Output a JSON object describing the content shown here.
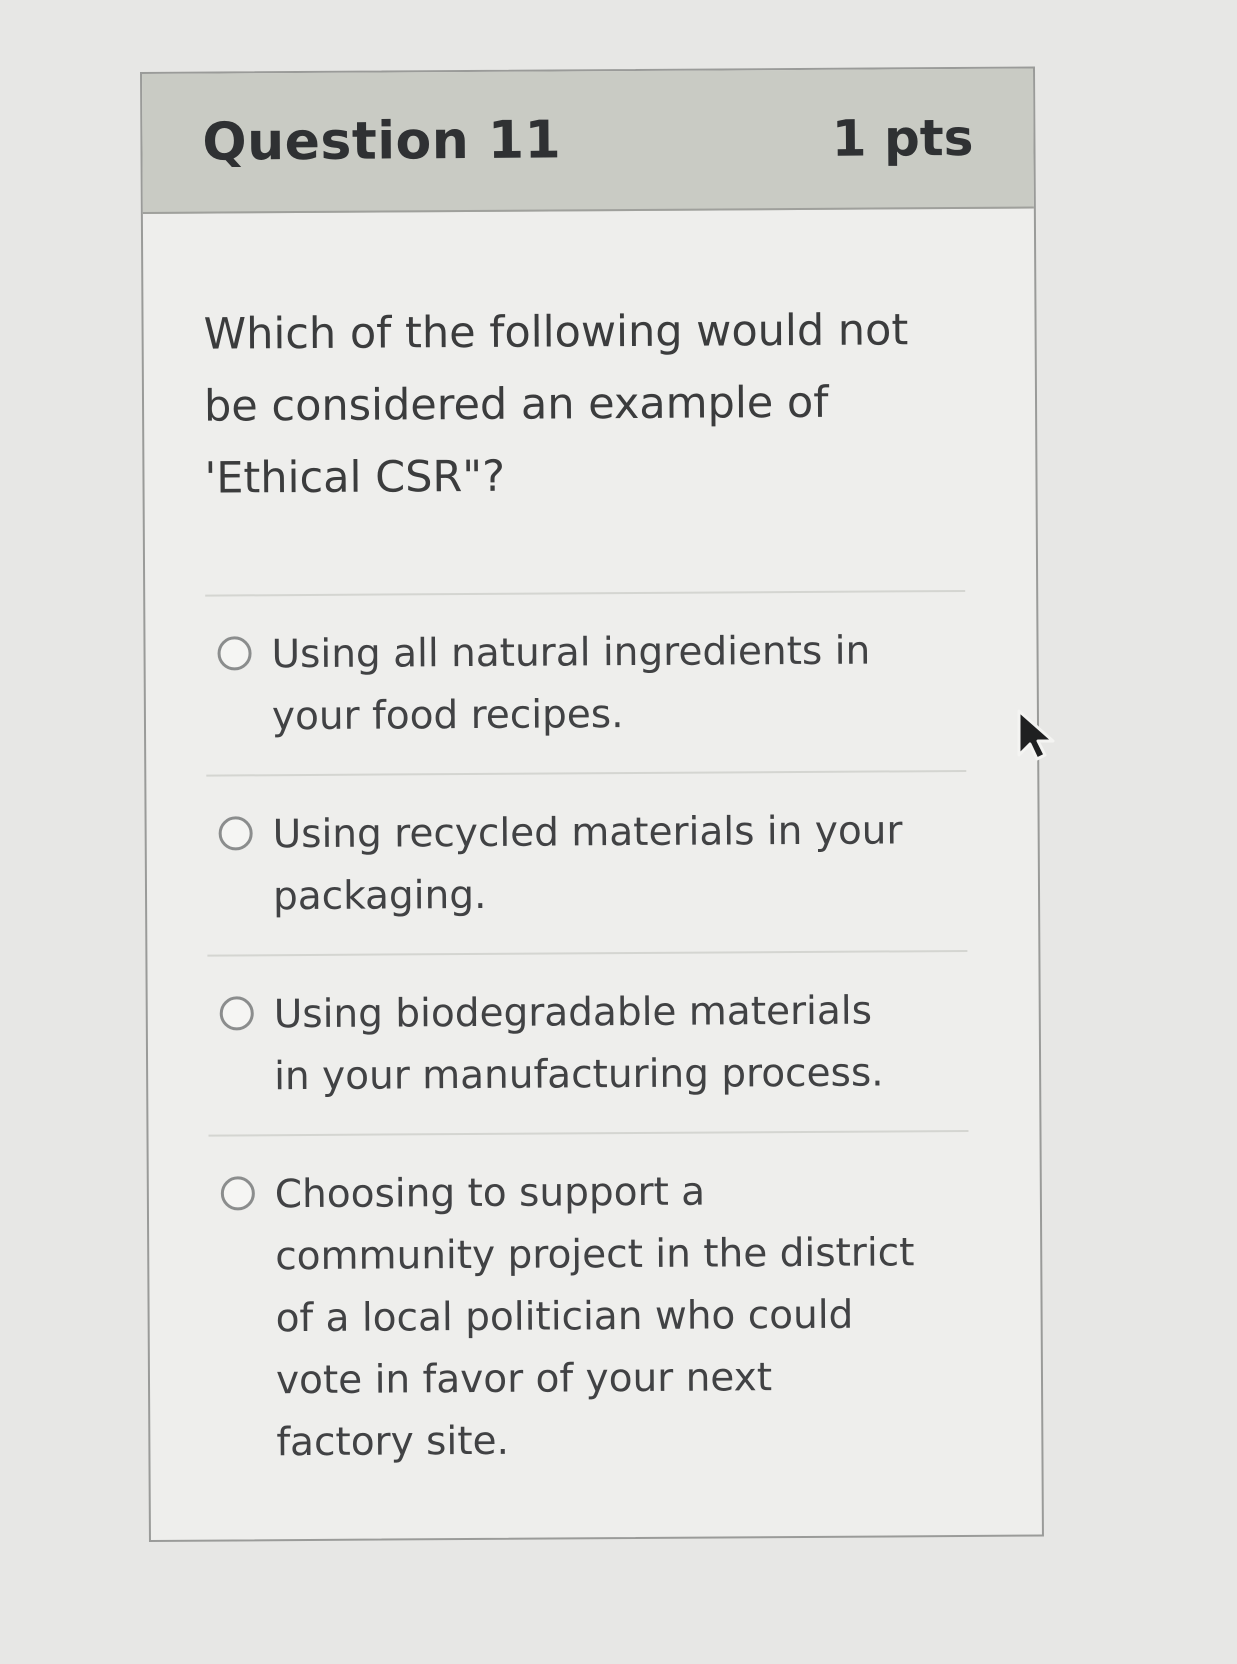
{
  "question": {
    "title": "Question 11",
    "points": "1 pts",
    "prompt": "Which of the following would not be considered an example of 'Ethical CSR\"?",
    "options": [
      {
        "label": "Using all natural ingredients in your food recipes."
      },
      {
        "label": "Using recycled materials in your packaging."
      },
      {
        "label": "Using biodegradable materials in your manufacturing process."
      },
      {
        "label": "Choosing to support a community project in the district of a local politician who could vote in favor of your next factory site."
      }
    ]
  },
  "colors": {
    "page_background": "#e7e7e5",
    "header_background": "#c9cbc4",
    "card_background": "#eeeeec",
    "text": "#3c3d3f"
  },
  "icons": {
    "radio": "radio-unselected-icon",
    "cursor": "mouse-pointer-icon"
  }
}
